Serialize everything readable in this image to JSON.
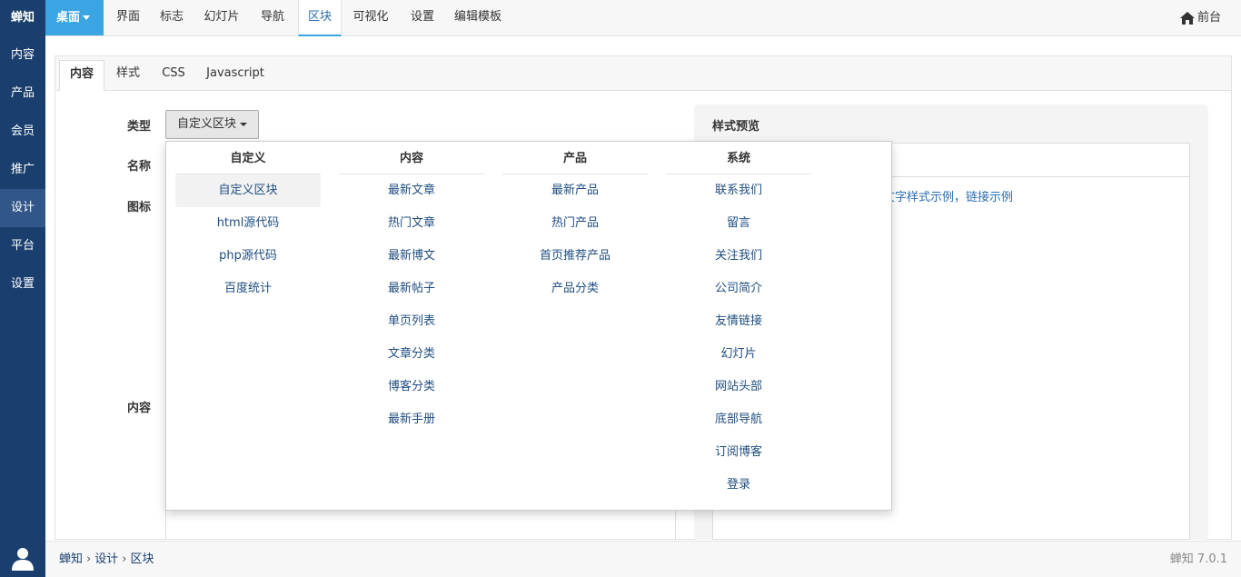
{
  "sidebar": {
    "brand": "蝉知",
    "items": [
      {
        "label": "内容",
        "active": false
      },
      {
        "label": "产品",
        "active": false
      },
      {
        "label": "会员",
        "active": false
      },
      {
        "label": "推广",
        "active": false
      },
      {
        "label": "设计",
        "active": true
      },
      {
        "label": "平台",
        "active": false
      },
      {
        "label": "设置",
        "active": false
      }
    ],
    "user_icon": "user-icon"
  },
  "topnav": {
    "desk_label": "桌面",
    "links": [
      "界面",
      "标志",
      "幻灯片",
      "导航",
      "区块",
      "可视化",
      "设置",
      "编辑模板"
    ],
    "active_link": "区块",
    "front_label": "前台",
    "front_icon": "home-icon"
  },
  "subtabs": [
    "内容",
    "样式",
    "CSS",
    "Javascript"
  ],
  "active_subtab": "内容",
  "form": {
    "type_label": "类型",
    "type_value": "自定义区块",
    "name_label": "名称",
    "icon_label": "图标",
    "content_label": "内容"
  },
  "preview": {
    "title": "样式预览",
    "text": "块文字样式示例，链接示例"
  },
  "dropdown": {
    "columns": [
      {
        "header": "自定义",
        "items": [
          "自定义区块",
          "html源代码",
          "php源代码",
          "百度统计"
        ]
      },
      {
        "header": "内容",
        "items": [
          "最新文章",
          "热门文章",
          "最新博文",
          "最新帖子",
          "单页列表",
          "文章分类",
          "博客分类",
          "最新手册"
        ]
      },
      {
        "header": "产品",
        "items": [
          "最新产品",
          "热门产品",
          "首页推荐产品",
          "产品分类"
        ]
      },
      {
        "header": "系统",
        "items": [
          "联系我们",
          "留言",
          "关注我们",
          "公司简介",
          "友情链接",
          "幻灯片",
          "网站头部",
          "底部导航",
          "订阅博客",
          "登录"
        ]
      }
    ],
    "selected": "自定义区块"
  },
  "footer": {
    "breadcrumb": [
      "蝉知",
      "设计",
      "区块"
    ],
    "separator": "›",
    "version": "蝉知 7.0.1"
  },
  "colors": {
    "sidebar_bg": "#1a3f6f",
    "accent": "#3ba5e4",
    "link": "#1f4d80"
  }
}
